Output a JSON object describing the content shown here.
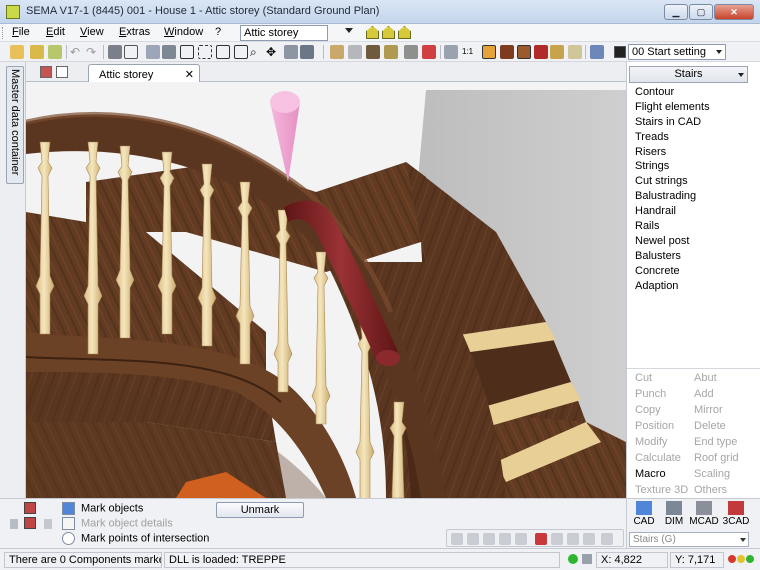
{
  "window": {
    "title": "SEMA V17-1 (8445) 001 - House 1  - Attic storey (Standard Ground Plan)",
    "minimize_icon": "minimize-icon",
    "maximize_icon": "maximize-icon",
    "close_icon": "close-icon"
  },
  "menu": {
    "items": [
      "File",
      "Edit",
      "View",
      "Extras",
      "Window",
      "?"
    ],
    "floor_value": "Attic storey"
  },
  "toolbar": {
    "setting_value": "00 Start setting"
  },
  "left_tab": {
    "label": "Master data container"
  },
  "doc_tab": {
    "label": "Attic storey",
    "close": "✕"
  },
  "right_panel": {
    "header": "Stairs",
    "commands": [
      "Contour",
      "Flight elements",
      "Stairs in CAD",
      "Treads",
      "Risers",
      "Strings",
      "Cut strings",
      "Balustrading",
      "Handrail",
      "Rails",
      "Newel post",
      "Balusters",
      "Concrete",
      "Adaption"
    ],
    "functions_left": [
      "Cut",
      "Punch",
      "Copy",
      "Position",
      "Modify",
      "Calculate",
      "Macro",
      "Texture 3D"
    ],
    "functions_right": [
      "Abut",
      "Add",
      "Mirror",
      "Delete",
      "End type",
      "Roof grid",
      "Scaling",
      "Others"
    ],
    "enabled_functions": [
      "Macro"
    ],
    "modes": [
      "CAD",
      "DIM",
      "MCAD",
      "3CAD"
    ],
    "stairs_combo": "Stairs (G)"
  },
  "bottom": {
    "mark_objects": "Mark objects",
    "mark_object_details": "Mark object details",
    "mark_points": "Mark points of intersection",
    "unmark_button": "Unmark"
  },
  "status": {
    "components": "There are 0 Components marked.",
    "dll": "DLL is loaded:  TREPPE",
    "x_label": "X:",
    "x_value": "4,822",
    "y_label": "Y:",
    "y_value": "7,171"
  },
  "colors": {
    "wood": "#5a3620",
    "wood_light": "#6e4529",
    "baluster": "#f0dcae",
    "handrail_selected": "#7a1f22",
    "cone": "#f2a6d0"
  }
}
